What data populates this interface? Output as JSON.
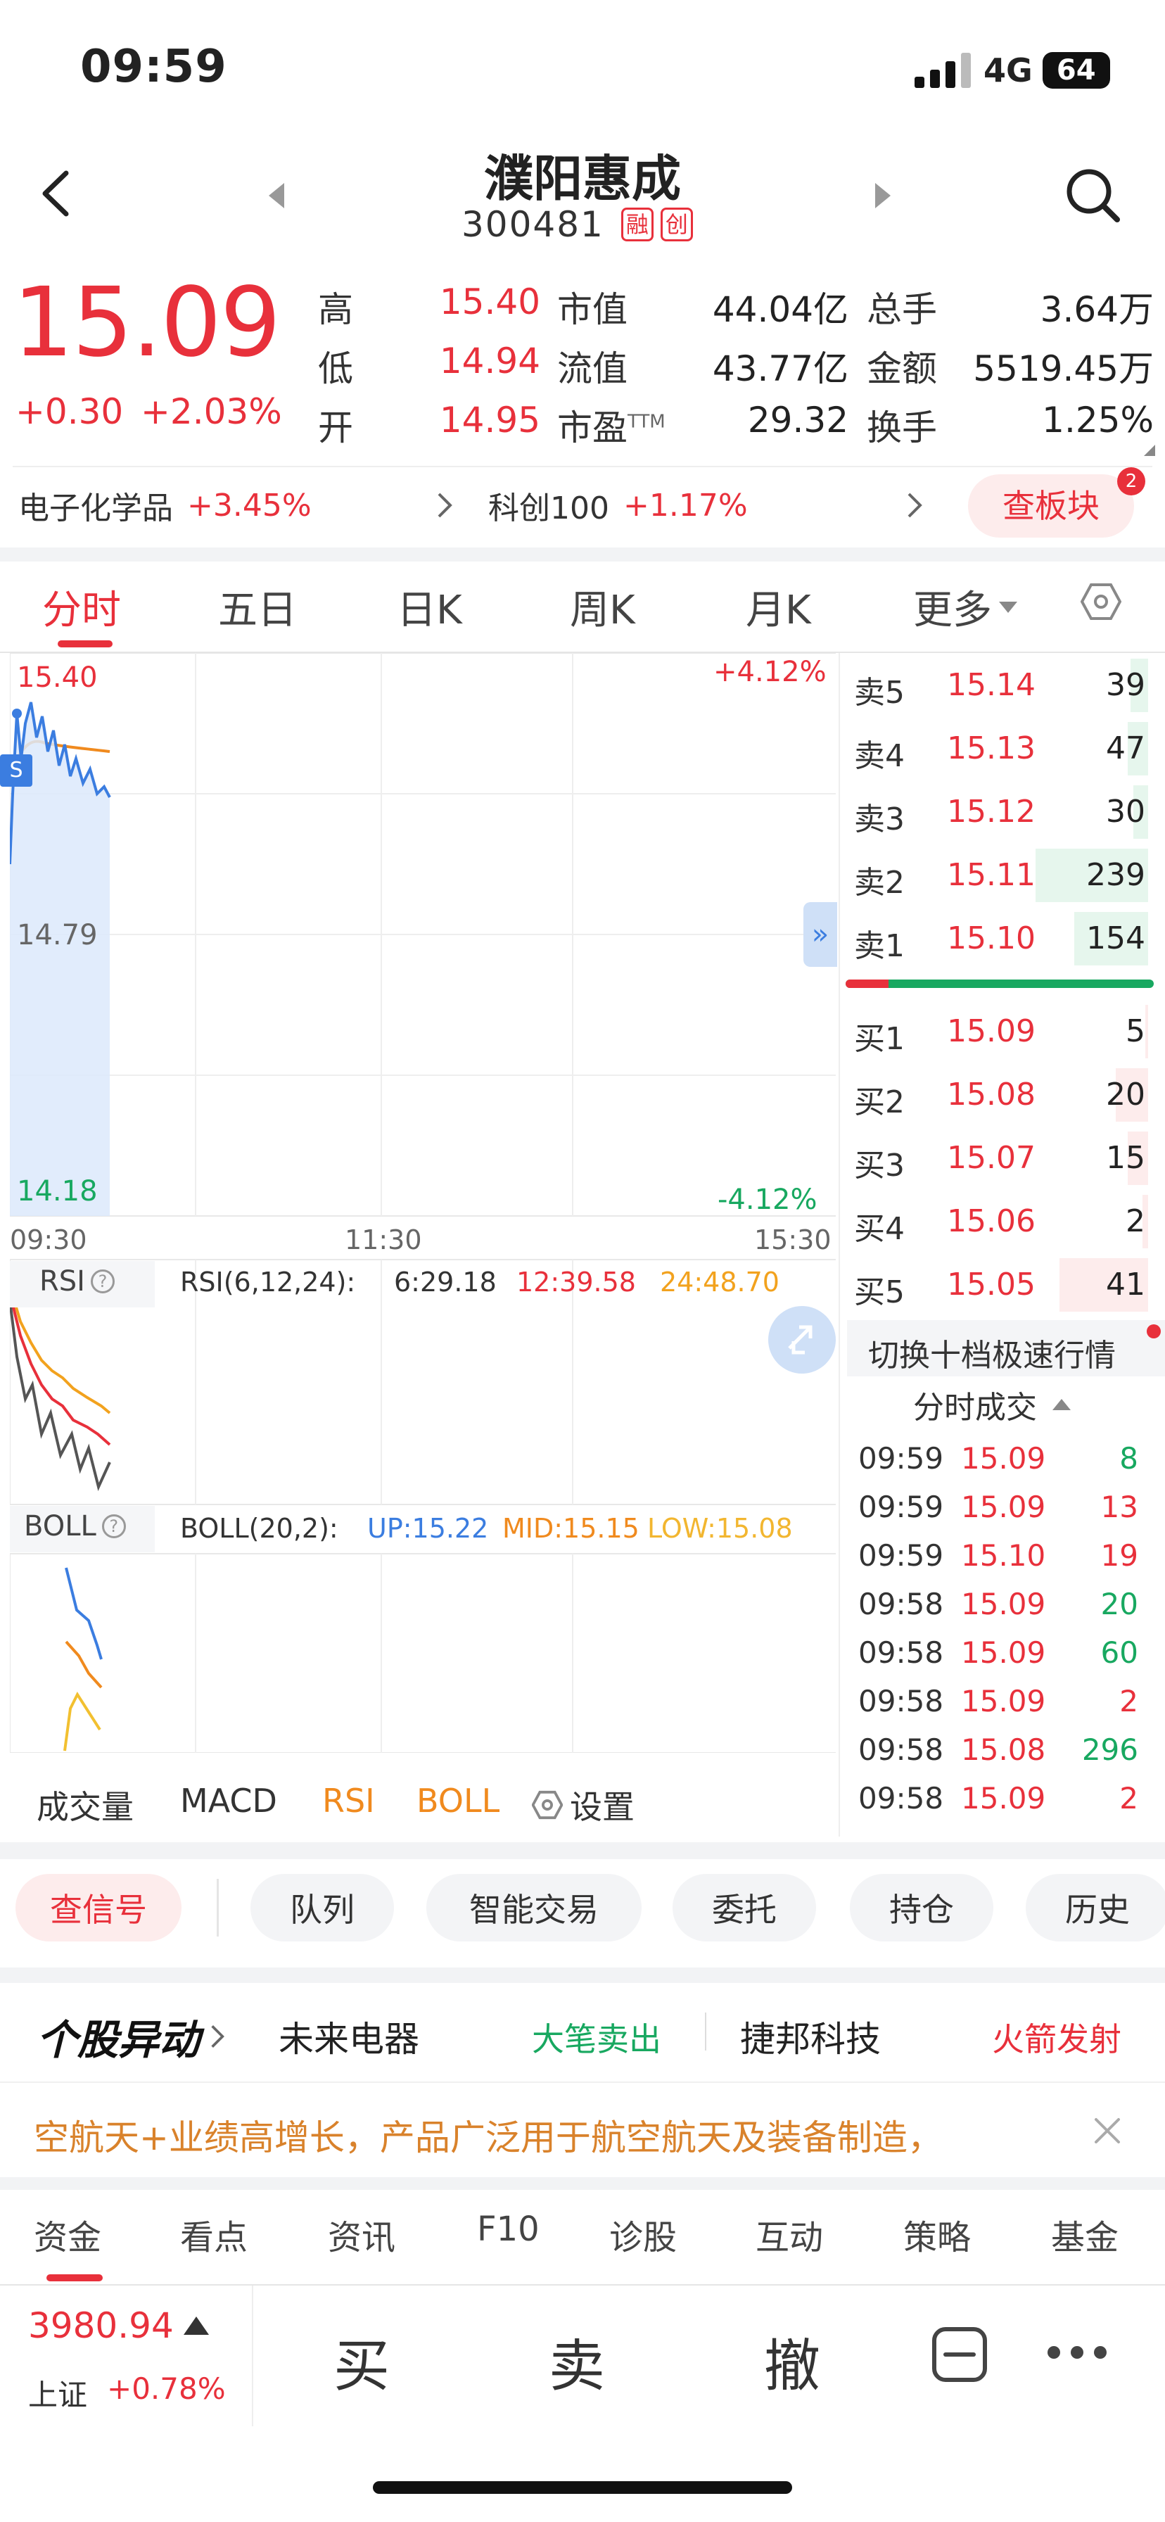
{
  "status_bar": {
    "time": "09:59",
    "network": "4G",
    "battery": "64"
  },
  "header": {
    "name": "濮阳惠成",
    "code": "300481",
    "badge1": "融",
    "badge2": "创"
  },
  "quote": {
    "price": "15.09",
    "change": "+0.30",
    "change_pct": "+2.03%"
  },
  "stats": [
    {
      "label": "高",
      "value": "15.40"
    },
    {
      "label": "市值",
      "value": "44.04亿"
    },
    {
      "label": "总手",
      "value": "3.64万"
    },
    {
      "label": "低",
      "value": "14.94"
    },
    {
      "label": "流值",
      "value": "43.77亿"
    },
    {
      "label": "金额",
      "value": "5519.45万"
    },
    {
      "label": "开",
      "value": "14.95"
    },
    {
      "label": "市盈",
      "sup": "TTM",
      "value": "29.32"
    },
    {
      "label": "换手",
      "value": "1.25%"
    }
  ],
  "sector": {
    "name1": "电子化学品",
    "pct1": "+3.45%",
    "name2": "科创100",
    "pct2": "+1.17%",
    "button": "查板块",
    "badge": "2"
  },
  "tabs": [
    "分时",
    "五日",
    "日K",
    "周K",
    "月K",
    "更多"
  ],
  "chart": {
    "y_high": "15.40",
    "y_mid": "14.79",
    "y_low": "14.18",
    "pct_high": "+4.12%",
    "pct_low": "-4.12%",
    "x_start": "09:30",
    "x_mid": "11:30",
    "x_end": "15:30",
    "s_marker": "S"
  },
  "rsi": {
    "name": "RSI",
    "params": "RSI(6,12,24):",
    "v6": "6:29.18",
    "v12": "12:39.58",
    "v24": "24:48.70"
  },
  "boll": {
    "name": "BOLL",
    "params": "BOLL(20,2):",
    "up": "UP:15.22",
    "mid": "MID:15.15",
    "low": "LOW:15.08"
  },
  "indicator_tabs": {
    "vol": "成交量",
    "macd": "MACD",
    "rsi": "RSI",
    "boll": "BOLL",
    "settings": "设置"
  },
  "orderbook": {
    "sell": [
      {
        "label": "卖5",
        "price": "15.14",
        "vol": "39",
        "frac": 0.06
      },
      {
        "label": "卖4",
        "price": "15.13",
        "vol": "47",
        "frac": 0.07
      },
      {
        "label": "卖3",
        "price": "15.12",
        "vol": "30",
        "frac": 0.05
      },
      {
        "label": "卖2",
        "price": "15.11",
        "vol": "239",
        "frac": 0.38
      },
      {
        "label": "卖1",
        "price": "15.10",
        "vol": "154",
        "frac": 0.25
      }
    ],
    "buy": [
      {
        "label": "买1",
        "price": "15.09",
        "vol": "5",
        "frac": 0.01
      },
      {
        "label": "买2",
        "price": "15.08",
        "vol": "20",
        "frac": 0.11
      },
      {
        "label": "买3",
        "price": "15.07",
        "vol": "15",
        "frac": 0.07
      },
      {
        "label": "买4",
        "price": "15.06",
        "vol": "2",
        "frac": 0.02
      },
      {
        "label": "买5",
        "price": "15.05",
        "vol": "41",
        "frac": 0.3
      }
    ],
    "switch_label": "切换十档极速行情"
  },
  "trades": {
    "title": "分时成交",
    "rows": [
      {
        "time": "09:59",
        "price": "15.09",
        "vol": "8",
        "dir": "green"
      },
      {
        "time": "09:59",
        "price": "15.09",
        "vol": "13",
        "dir": "red"
      },
      {
        "time": "09:59",
        "price": "15.10",
        "vol": "19",
        "dir": "red"
      },
      {
        "time": "09:58",
        "price": "15.09",
        "vol": "20",
        "dir": "green"
      },
      {
        "time": "09:58",
        "price": "15.09",
        "vol": "60",
        "dir": "green"
      },
      {
        "time": "09:58",
        "price": "15.09",
        "vol": "2",
        "dir": "red"
      },
      {
        "time": "09:58",
        "price": "15.08",
        "vol": "296",
        "dir": "green"
      },
      {
        "time": "09:58",
        "price": "15.09",
        "vol": "2",
        "dir": "red"
      }
    ]
  },
  "actions": [
    "查信号",
    "队列",
    "智能交易",
    "委托",
    "持仓",
    "历史"
  ],
  "news": {
    "title": "个股异动",
    "item1": "未来电器",
    "tag1": "大笔卖出",
    "item2": "捷邦科技",
    "tag2": "火箭发射",
    "banner": "空航天+业绩高增长，产品广泛用于航空航天及装备制造，"
  },
  "bottom_tabs": [
    "资金",
    "看点",
    "资讯",
    "F10",
    "诊股",
    "互动",
    "策略",
    "基金"
  ],
  "footer": {
    "index_value": "3980.94",
    "index_name": "上证",
    "index_pct": "+0.78%",
    "buy": "买",
    "sell": "卖",
    "cancel": "撤"
  },
  "colors": {
    "up": "#e8303b",
    "down": "#18a860",
    "line": "#3b7de0",
    "avg": "#f08a1e"
  }
}
